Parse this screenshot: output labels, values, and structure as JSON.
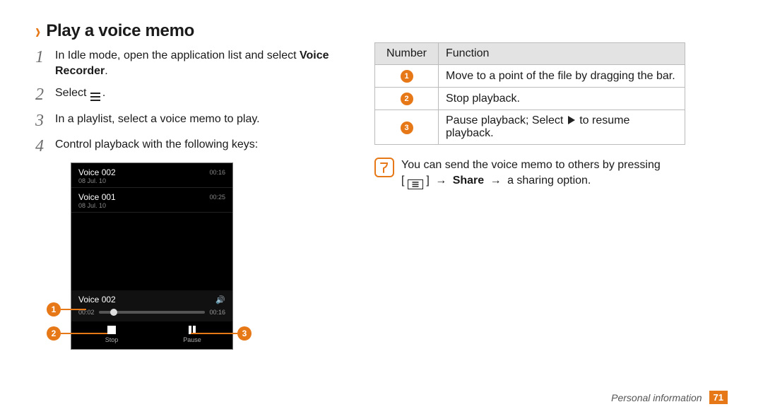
{
  "heading": "Play a voice memo",
  "steps": [
    {
      "num": "1",
      "pre": "In Idle mode, open the application list and select ",
      "strong": "Voice Recorder",
      "post": "."
    },
    {
      "num": "2",
      "pre": "Select ",
      "icon": "list",
      "post": "."
    },
    {
      "num": "3",
      "pre": "In a playlist, select a voice memo to play."
    },
    {
      "num": "4",
      "pre": "Control playback with the following keys:"
    }
  ],
  "phone": {
    "playlist": [
      {
        "title": "Voice 002",
        "date": "08 Jul. 10",
        "dur": "00:16"
      },
      {
        "title": "Voice 001",
        "date": "08 Jul. 10",
        "dur": "00:25"
      }
    ],
    "nowplaying": "Voice 002",
    "time_cur": "00:02",
    "time_tot": "00:16",
    "stop_label": "Stop",
    "pause_label": "Pause"
  },
  "callouts": {
    "c1": "1",
    "c2": "2",
    "c3": "3"
  },
  "table": {
    "head_num": "Number",
    "head_func": "Function",
    "rows": [
      {
        "n": "1",
        "f": "Move to a point of the file by dragging the bar."
      },
      {
        "n": "2",
        "f": "Stop playback."
      },
      {
        "n": "3",
        "f_pre": "Pause playback; Select ",
        "f_icon": "play",
        "f_post": " to resume playback."
      }
    ]
  },
  "note": {
    "line1": "You can send the voice memo to others by pressing",
    "bracket_open": "[ ",
    "bracket_close": " ]",
    "share": "Share",
    "trail": "a sharing option."
  },
  "footer": {
    "section": "Personal information",
    "page": "71"
  }
}
